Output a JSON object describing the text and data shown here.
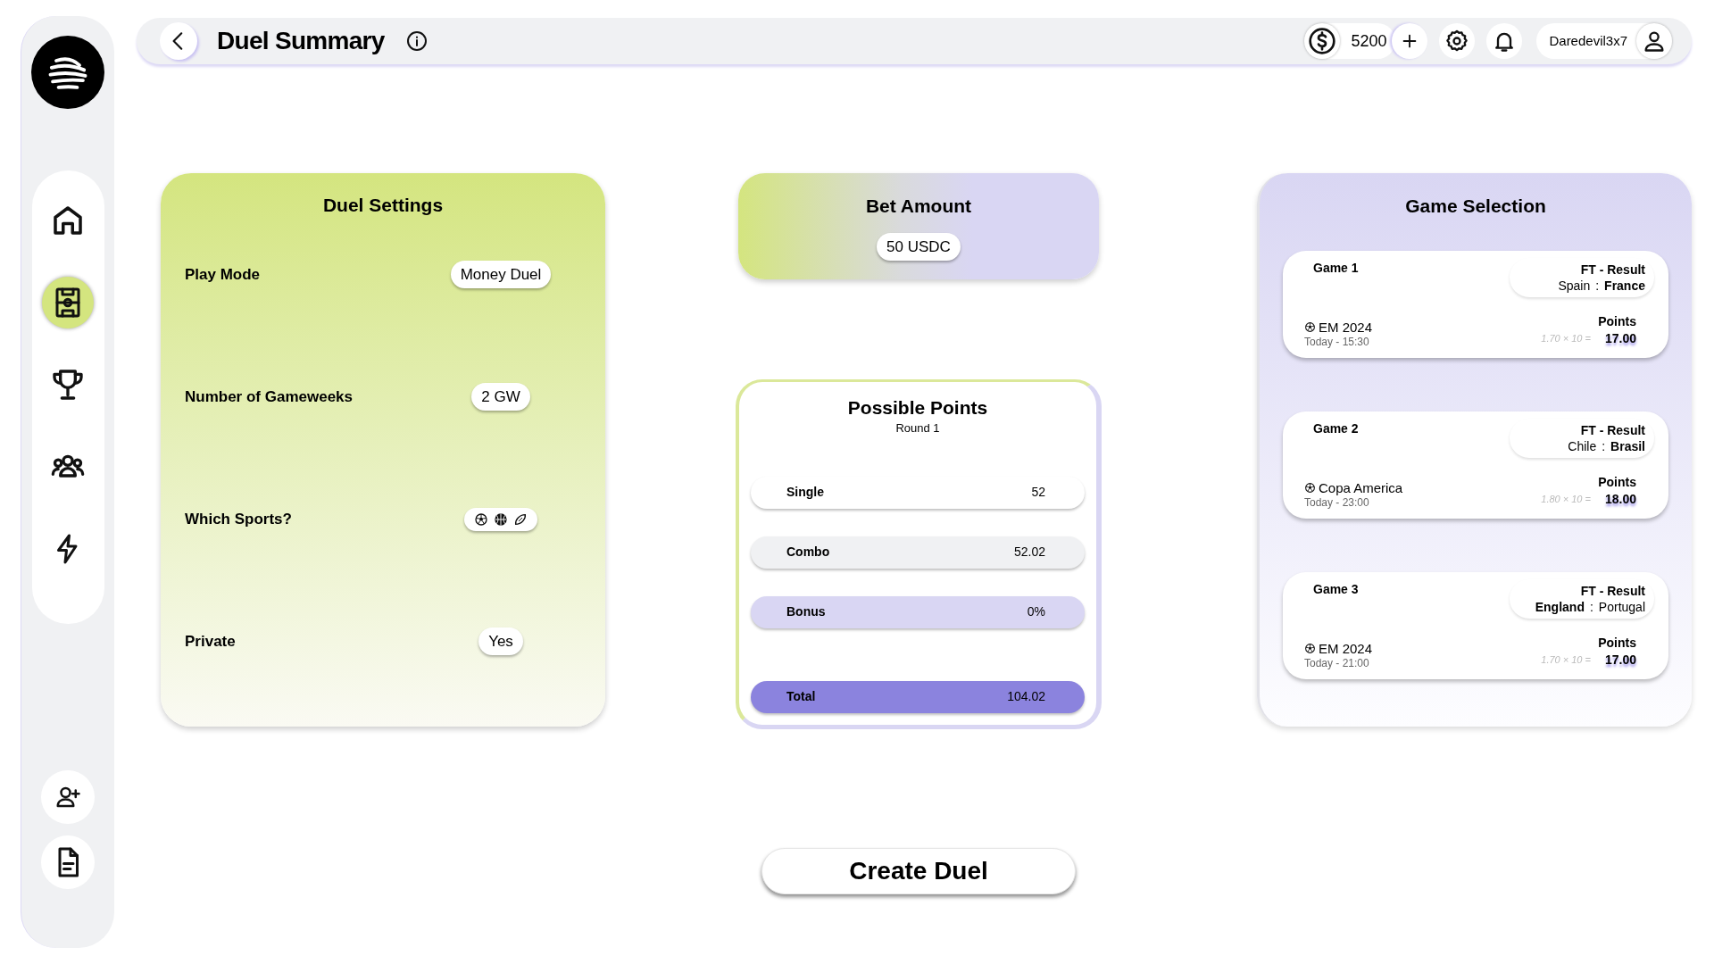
{
  "header": {
    "title": "Duel Summary",
    "balance": "5200",
    "username": "Daredevil3x7"
  },
  "sidebar": {
    "nav": [
      {
        "kind": "home",
        "selected": false
      },
      {
        "kind": "field",
        "selected": true
      },
      {
        "kind": "trophy",
        "selected": false
      },
      {
        "kind": "people",
        "selected": false
      },
      {
        "kind": "bolt",
        "selected": false
      }
    ],
    "actions": [
      {
        "kind": "add-user"
      },
      {
        "kind": "document"
      }
    ]
  },
  "duel_settings": {
    "title": "Duel Settings",
    "rows": [
      {
        "kind": "text",
        "label": "Play Mode",
        "value": "Money Duel"
      },
      {
        "kind": "text",
        "label": "Number of Gameweeks",
        "value": "2 GW"
      },
      {
        "kind": "sports",
        "label": "Which Sports?",
        "sports": [
          {
            "kind": "soccer"
          },
          {
            "kind": "basketball"
          },
          {
            "kind": "football"
          }
        ]
      },
      {
        "kind": "text",
        "label": "Private",
        "value": "Yes"
      }
    ]
  },
  "bet_amount": {
    "title": "Bet Amount",
    "value": "50 USDC"
  },
  "possible_points": {
    "title": "Possible Points",
    "subtitle": "Round 1",
    "rows": [
      {
        "kind": "plain",
        "label": "Single",
        "value": "52"
      },
      {
        "kind": "shaded",
        "label": "Combo",
        "value": "52.02"
      },
      {
        "kind": "bonus",
        "label": "Bonus",
        "value": "0%"
      },
      {
        "kind": "total",
        "label": "Total",
        "value": "104.02"
      }
    ]
  },
  "game_selection": {
    "title": "Game Selection",
    "games": [
      {
        "title": "Game 1",
        "market": "FT - Result",
        "home": {
          "name": "Spain",
          "picked": false
        },
        "separator": ":",
        "away": {
          "name": "France",
          "picked": true
        },
        "competition": "EM 2024",
        "time": "Today - 15:30",
        "points_label": "Points",
        "formula": "1.70 × 10 =",
        "points": "17.00"
      },
      {
        "title": "Game 2",
        "market": "FT - Result",
        "home": {
          "name": "Chile",
          "picked": false
        },
        "separator": ":",
        "away": {
          "name": "Brasil",
          "picked": true
        },
        "competition": "Copa America",
        "time": "Today - 23:00",
        "points_label": "Points",
        "formula": "1.80 × 10 =",
        "points": "18.00"
      },
      {
        "title": "Game 3",
        "market": "FT - Result",
        "home": {
          "name": "England",
          "picked": true
        },
        "separator": ":",
        "away": {
          "name": "Portugal",
          "picked": false
        },
        "competition": "EM 2024",
        "time": "Today - 21:00",
        "points_label": "Points",
        "formula": "1.70 × 10 =",
        "points": "17.00"
      }
    ]
  },
  "create_button": "Create Duel"
}
